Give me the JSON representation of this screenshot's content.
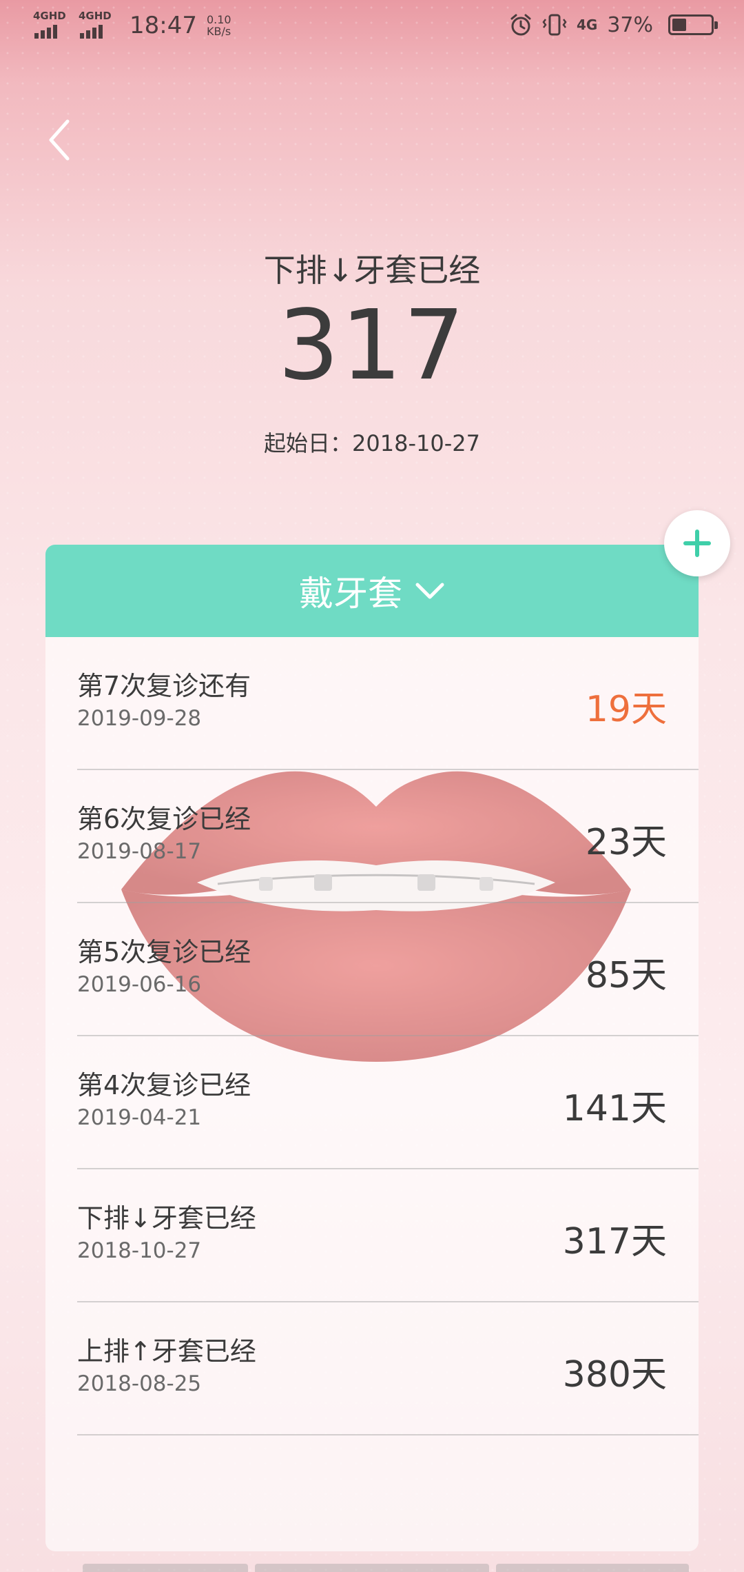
{
  "status_bar": {
    "sim1_label": "4GHD",
    "sim2_label": "4GHD",
    "time": "18:47",
    "speed_value": "0.10",
    "speed_unit": "KB/s",
    "network_label": "4G",
    "battery_percent": "37%",
    "battery_level": 0.37
  },
  "header": {
    "headline": "下排↓牙套已经",
    "day_count": "317",
    "start_date_text": "起始日：2018-10-27"
  },
  "card": {
    "title": "戴牙套",
    "accent_color": "#6fdbc4",
    "rows": [
      {
        "title": "第7次复诊还有",
        "date": "2019-09-28",
        "value": "19天",
        "highlight": true
      },
      {
        "title": "第6次复诊已经",
        "date": "2019-08-17",
        "value": "23天",
        "highlight": false
      },
      {
        "title": "第5次复诊已经",
        "date": "2019-06-16",
        "value": "85天",
        "highlight": false
      },
      {
        "title": "第4次复诊已经",
        "date": "2019-04-21",
        "value": "141天",
        "highlight": false
      },
      {
        "title": "下排↓牙套已经",
        "date": "2018-10-27",
        "value": "317天",
        "highlight": false
      },
      {
        "title": "上排↑牙套已经",
        "date": "2018-08-25",
        "value": "380天",
        "highlight": false
      }
    ]
  },
  "icons": {
    "back": "back-arrow-icon",
    "add": "plus-icon",
    "dropdown": "chevron-down-icon",
    "alarm": "alarm-icon",
    "vibrate": "vibrate-icon",
    "battery": "battery-icon"
  },
  "colors": {
    "highlight": "#ee6f3c",
    "add_button_plus": "#3fcfa9"
  }
}
